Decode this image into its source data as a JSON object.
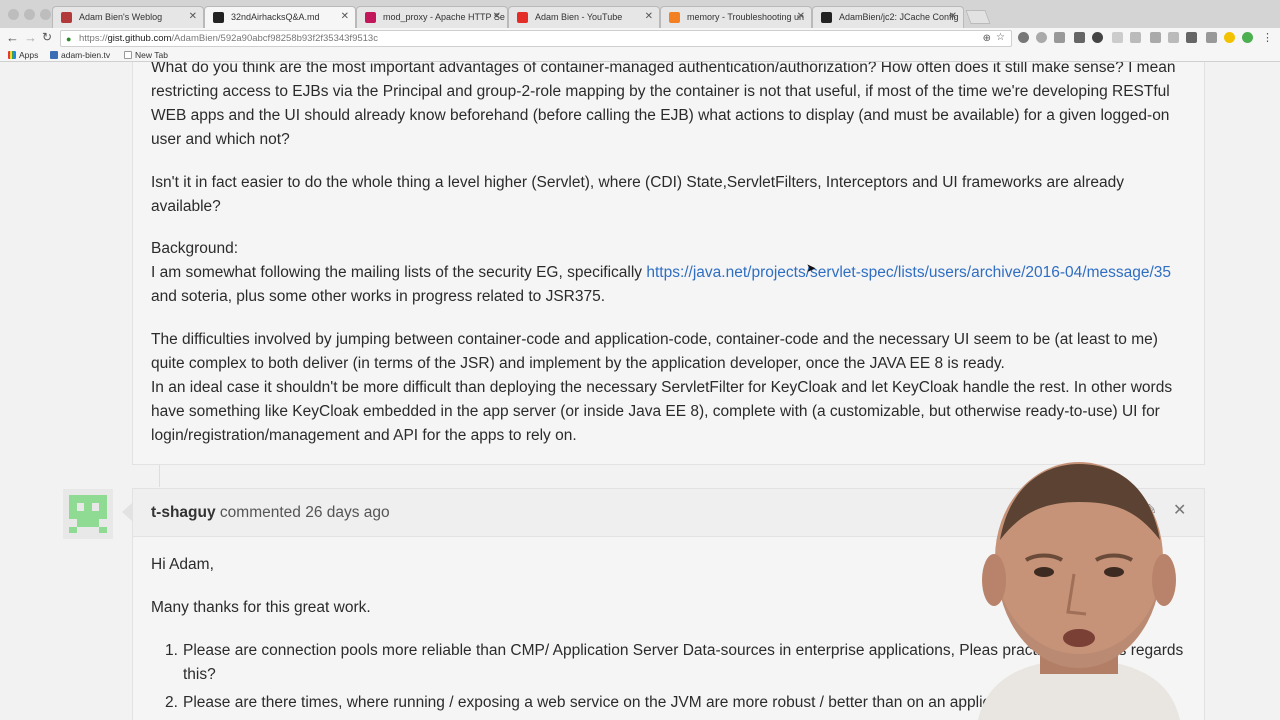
{
  "browser": {
    "tabs": [
      {
        "title": "Adam Bien's Weblog",
        "favicon": "#b33a3a",
        "active": false
      },
      {
        "title": "32ndAirhacksQ&A.md",
        "favicon": "#222222",
        "active": true
      },
      {
        "title": "mod_proxy - Apache HTTP Se",
        "favicon": "#c2185b",
        "active": false
      },
      {
        "title": "Adam Bien - YouTube",
        "favicon": "#e52d27",
        "active": false
      },
      {
        "title": "memory - Troubleshooting un",
        "favicon": "#f48024",
        "active": false
      },
      {
        "title": "AdamBien/jc2: JCache Config",
        "favicon": "#222222",
        "active": false
      }
    ],
    "url_scheme": "https://",
    "url_host": "gist.github.com",
    "url_path": "/AdamBien/592a90abcf98258b93f2f35343f9513c",
    "bookmarks": [
      {
        "label": "Apps",
        "icon": "apps-grid-icon"
      },
      {
        "label": "adam-bien.tv",
        "icon": "bookmark-u-icon"
      },
      {
        "label": "New Tab",
        "icon": "page-icon"
      }
    ]
  },
  "gist": {
    "comment1": {
      "p1": "What do you think are the most important advantages of container-managed authentication/authorization? How often does it still make sense? I mean restricting access to EJBs via the Principal and group-2-role mapping by the container is not that useful, if most of the time we're developing RESTful WEB apps and the UI should already know beforehand (before calling the EJB) what actions to display (and must be available) for a given logged-on user and which not?",
      "p2": "Isn't it in fact easier to do the whole thing a level higher (Servlet), where (CDI) State,ServletFilters, Interceptors and UI frameworks are already available?",
      "background_heading": "Background:",
      "background_text": "I am somewhat following the mailing lists of the security EG, specifically",
      "background_link": "https://java.net/projects/servlet-spec/lists/users/archive/2016-04/message/35",
      "background_tail": "and soteria, plus some other works in progress related to JSR375.",
      "p4": "The difficulties involved by jumping between container-code and application-code, container-code and the necessary UI seem to be (at least to me) quite complex to both deliver (in terms of the JSR) and implement by the application developer, once the JAVA EE 8 is ready.",
      "p5": "In an ideal case it shouldn't be more difficult than deploying the necessary ServletFilter for KeyCloak and let KeyCloak handle the rest. In other words have something like KeyCloak embedded in the app server (or inside Java EE 8), complete with (a customizable, but otherwise ready-to-use) UI for login/registration/management and API for the apps to rely on."
    },
    "comment2": {
      "author": "t-shaguy",
      "meta": "commented 26 days ago",
      "greeting": "Hi Adam,",
      "thanks": "Many thanks for this great work.",
      "items": [
        {
          "num": "1.",
          "text": "Please are connection pools more reliable than CMP/ Application Server Data-sources in enterprise applications, Pleas practice advise as regards this?"
        },
        {
          "num": "2.",
          "text": "Please are there times, where running / exposing a web service on the JVM are more robust / better than on an applic ildfly or"
        }
      ]
    }
  }
}
